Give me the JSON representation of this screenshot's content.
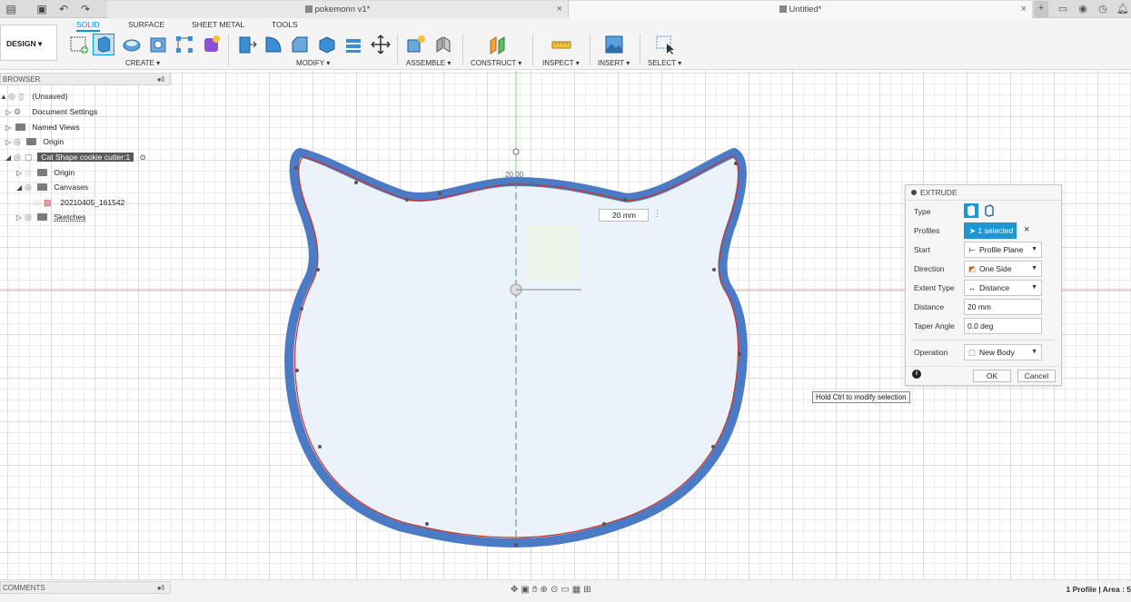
{
  "tabs": {
    "doc1": "pokemonn v1*",
    "doc2": "Untitled*"
  },
  "toolbar": {
    "design_label": "DESIGN ▾",
    "workspaces": [
      "SOLID",
      "SURFACE",
      "SHEET METAL",
      "TOOLS"
    ],
    "groups": {
      "create": "CREATE ▾",
      "modify": "MODIFY ▾",
      "assemble": "ASSEMBLE ▾",
      "construct": "CONSTRUCT ▾",
      "inspect": "INSPECT ▾",
      "insert": "INSERT ▾",
      "select": "SELECT ▾"
    }
  },
  "browser": {
    "title": "BROWSER",
    "items": {
      "root": "(Unsaved)",
      "doc_settings": "Document Settings",
      "named_views": "Named Views",
      "origin": "Origin",
      "component": "Cat Shape cookie cutter:1",
      "comp_origin": "Origin",
      "canvases": "Canvases",
      "canvas_item": "20210405_161542",
      "sketches": "Sketches"
    }
  },
  "canvas": {
    "dimension_value": "20 mm",
    "dimension_label": "20.00"
  },
  "extrude": {
    "title": "EXTRUDE",
    "labels": {
      "type": "Type",
      "profiles": "Profiles",
      "start": "Start",
      "direction": "Direction",
      "extent_type": "Extent Type",
      "distance": "Distance",
      "taper_angle": "Taper Angle",
      "operation": "Operation"
    },
    "values": {
      "profiles": "1 selected",
      "start": "Profile Plane",
      "direction": "One Side",
      "extent_type": "Distance",
      "distance": "20 mm",
      "taper_angle": "0.0 deg",
      "operation": "New Body"
    },
    "ok": "OK",
    "cancel": "Cancel"
  },
  "tooltip": "Hold Ctrl to modify selection",
  "comments": "COMMENTS",
  "status": "1 Profile | Area : 5",
  "colors": {
    "accent": "#0696d7",
    "shape_stroke": "#4a7bc4",
    "shape_fill": "#eaf2fb",
    "profile_line": "#d0312d"
  }
}
